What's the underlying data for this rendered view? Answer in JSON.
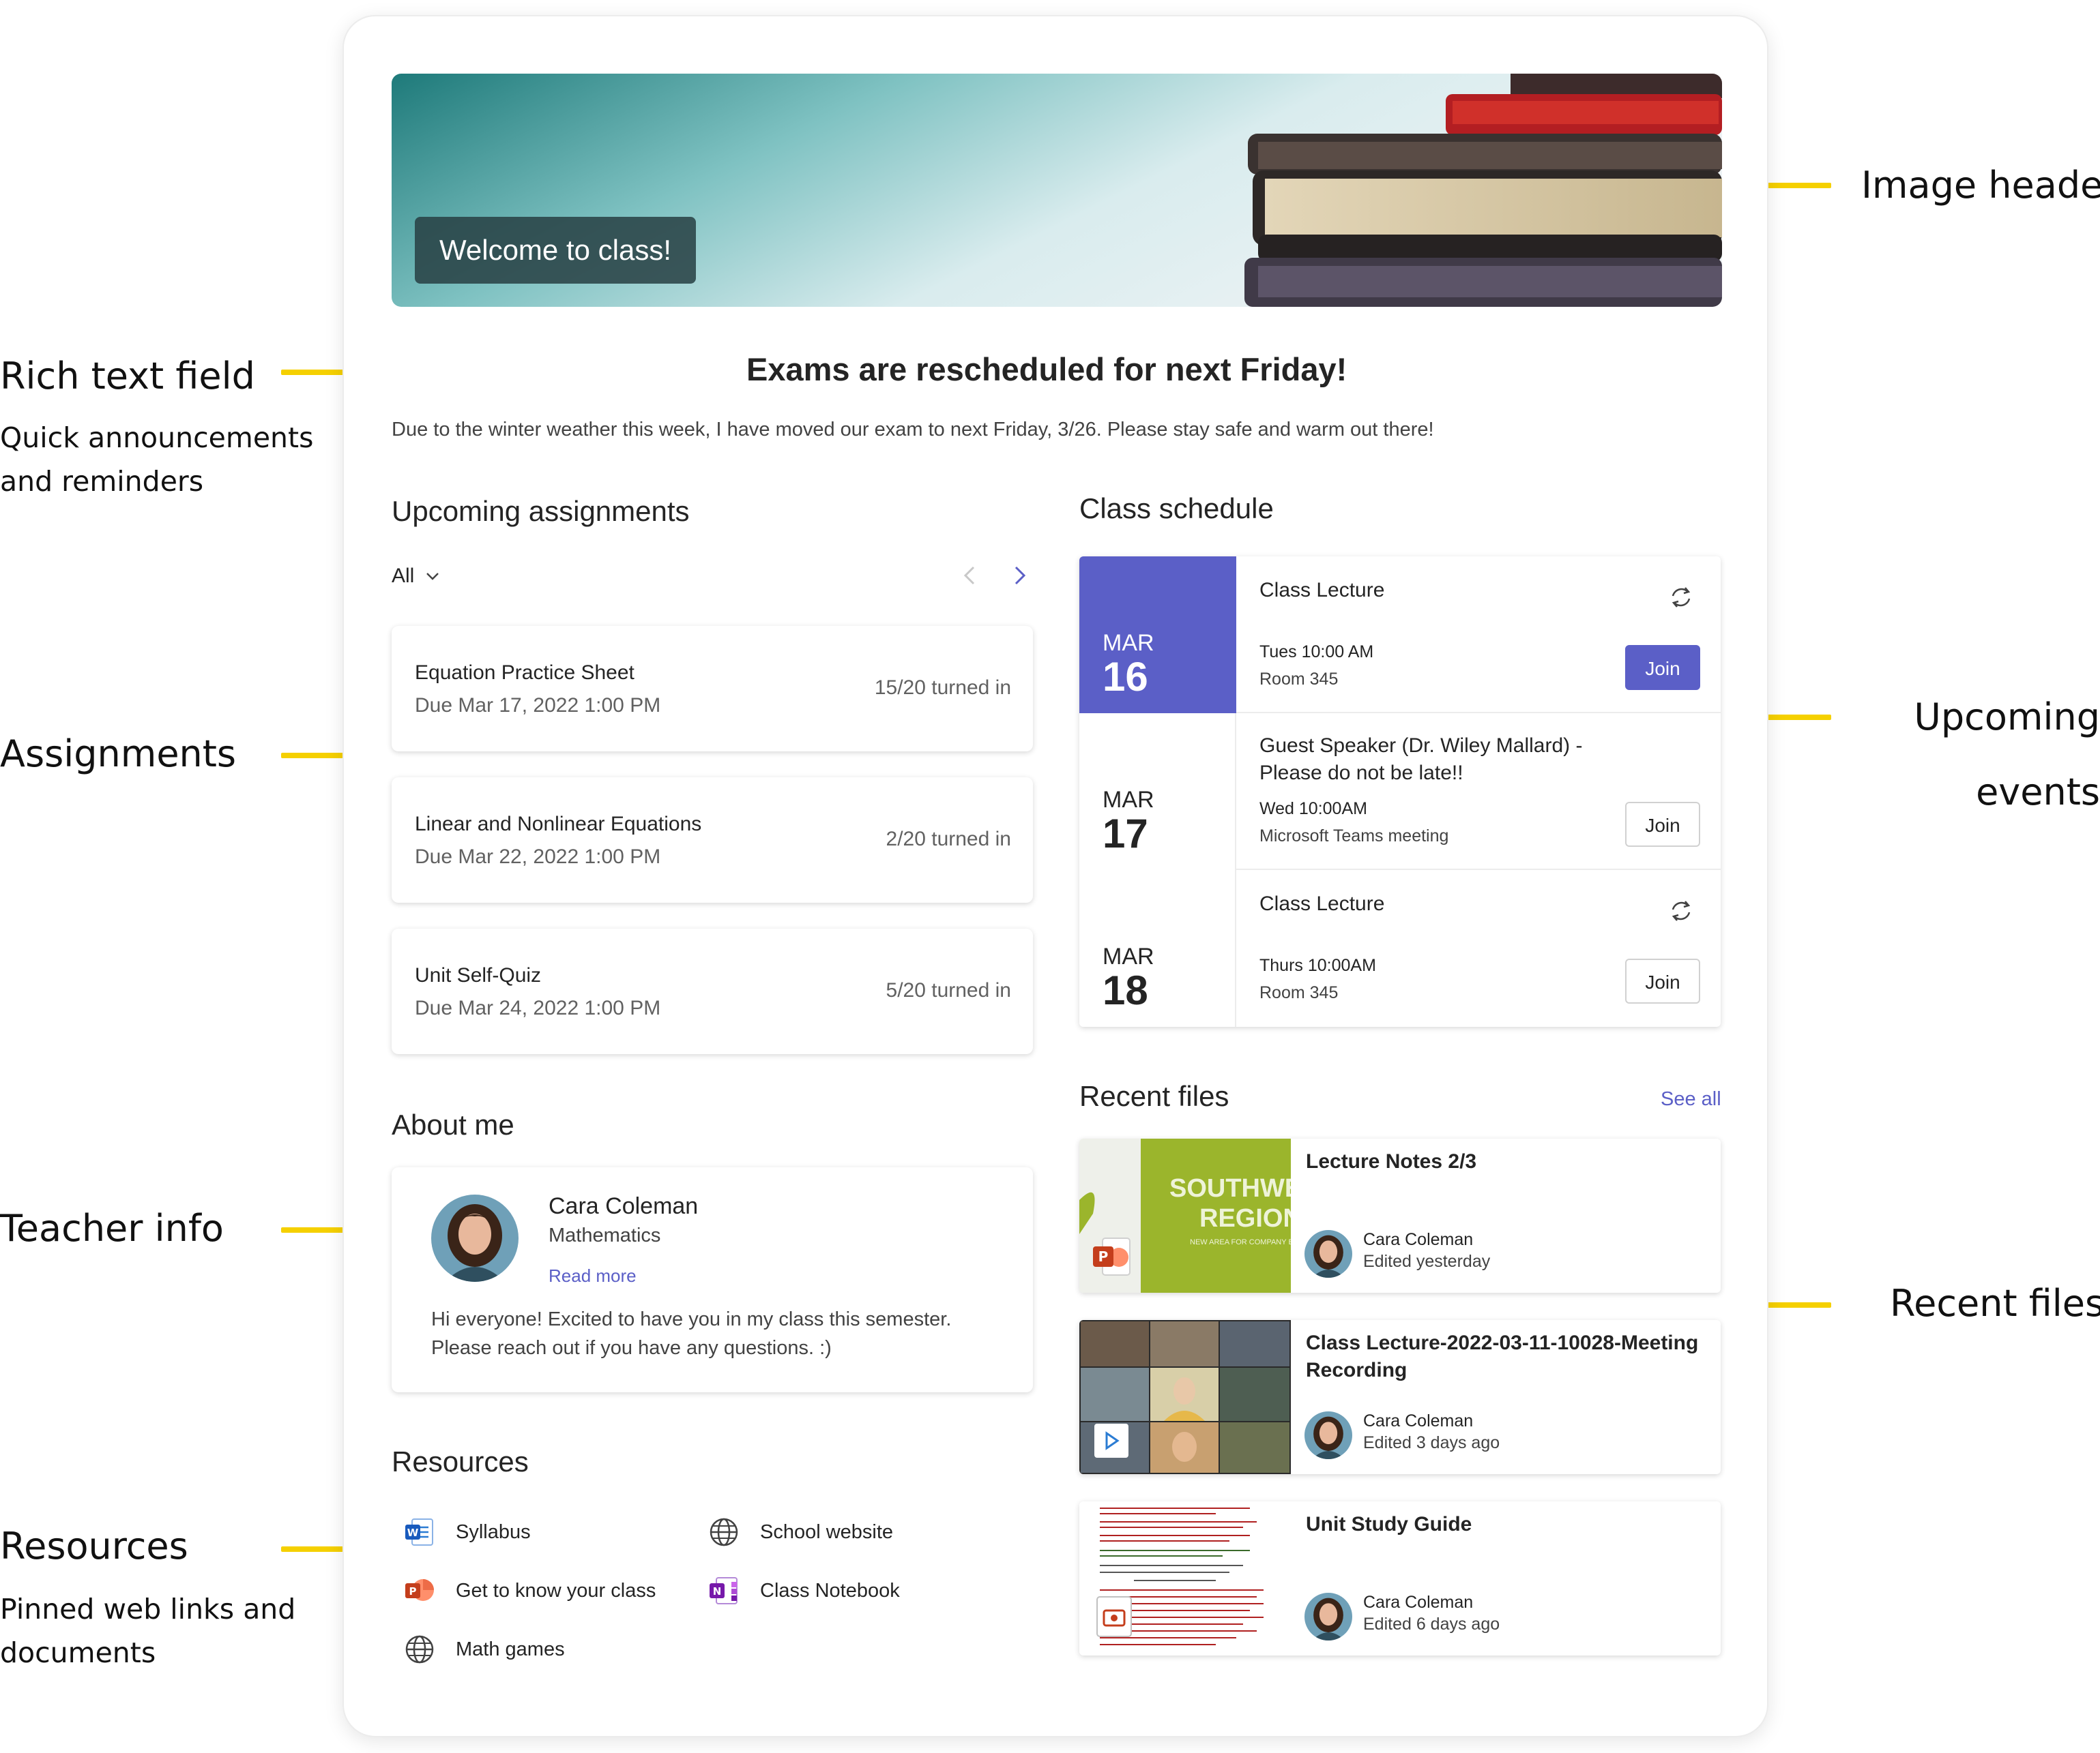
{
  "annotations": {
    "image_header": "Image header",
    "rich_text_title": "Rich text field",
    "rich_text_sub_1": "Quick announcements",
    "rich_text_sub_2": "and reminders",
    "assignments": "Assignments",
    "upcoming_1": "Upcoming",
    "upcoming_2": "events",
    "teacher_info": "Teacher info",
    "recent_files": "Recent files",
    "resources_title": "Resources",
    "resources_sub_1": "Pinned web links and",
    "resources_sub_2": "documents"
  },
  "header": {
    "welcome": "Welcome to class!"
  },
  "announcement": {
    "title": "Exams are rescheduled for next Friday!",
    "body": "Due to the winter weather this week, I have moved our exam to next Friday, 3/26. Please stay safe and warm out there!"
  },
  "assignments": {
    "title": "Upcoming assignments",
    "filter": "All",
    "items": [
      {
        "name": "Equation Practice Sheet",
        "due": "Due Mar 17, 2022 1:00 PM",
        "count": "15/20 turned in"
      },
      {
        "name": "Linear and Nonlinear Equations",
        "due": "Due Mar 22, 2022 1:00 PM",
        "count": "2/20 turned in"
      },
      {
        "name": "Unit Self-Quiz",
        "due": "Due Mar 24, 2022 1:00 PM",
        "count": "5/20 turned in"
      }
    ]
  },
  "about": {
    "title": "About me",
    "name": "Cara Coleman",
    "subject": "Mathematics",
    "read_more": "Read more",
    "bio": "Hi everyone! Excited to have you in my class this semester. Please reach out if you have any questions. :)"
  },
  "resources": {
    "title": "Resources",
    "items": [
      {
        "label": "Syllabus",
        "icon": "word-icon"
      },
      {
        "label": "School website",
        "icon": "globe-icon"
      },
      {
        "label": "Get to know your class",
        "icon": "powerpoint-icon"
      },
      {
        "label": "Class Notebook",
        "icon": "onenote-icon"
      },
      {
        "label": "Math games",
        "icon": "globe-icon"
      }
    ]
  },
  "schedule": {
    "title": "Class schedule",
    "events": [
      {
        "month": "MAR",
        "day": "16",
        "title": "Class Lecture",
        "time": "Tues 10:00 AM",
        "place": "Room 345",
        "join": "Join",
        "recurring": true
      },
      {
        "month": "MAR",
        "day": "17",
        "title": "Guest Speaker (Dr. Wiley Mallard) - Please do not be late!!",
        "time": "Wed 10:00AM",
        "place": "Microsoft Teams meeting",
        "join": "Join",
        "recurring": false
      },
      {
        "month": "MAR",
        "day": "18",
        "title": "Class Lecture",
        "time": "Thurs 10:00AM",
        "place": "Room 345",
        "join": "Join",
        "recurring": true
      }
    ]
  },
  "files": {
    "title": "Recent files",
    "see_all": "See all",
    "items": [
      {
        "title": "Lecture Notes 2/3",
        "author": "Cara Coleman",
        "edited": "Edited yesterday",
        "thumb_line_1": "SOUTHWE",
        "thumb_line_2": "REGION",
        "thumb_line_3": "NEW AREA FOR COMPANY E"
      },
      {
        "title": "Class Lecture-2022-03-11-10028-Meeting Recording",
        "author": "Cara Coleman",
        "edited": "Edited 3 days ago"
      },
      {
        "title": "Unit Study Guide",
        "author": "Cara Coleman",
        "edited": "Edited 6 days ago"
      }
    ]
  },
  "colors": {
    "accent": "#5b5fc7",
    "annotation_line": "#f5d000"
  }
}
